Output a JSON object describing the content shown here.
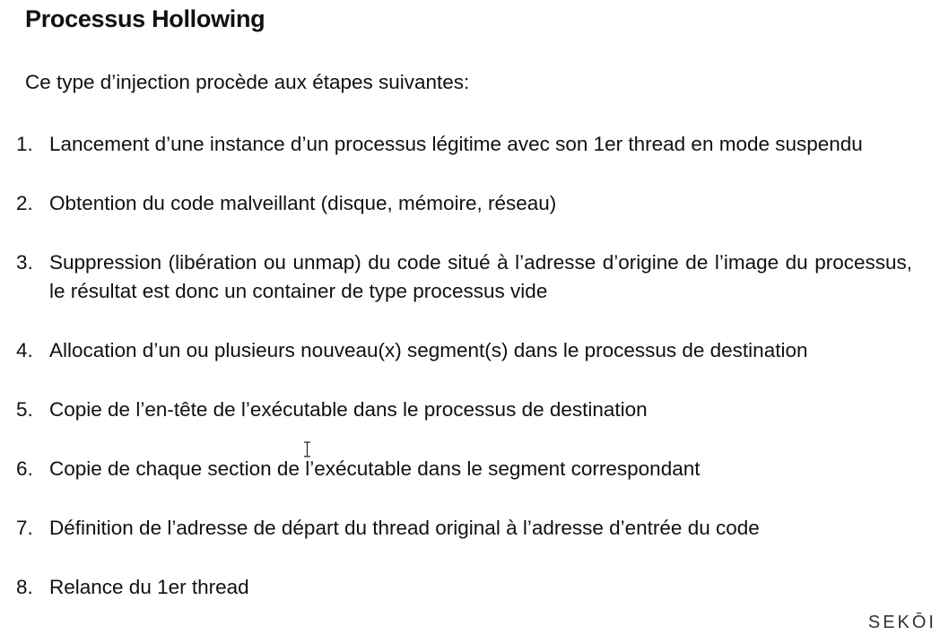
{
  "title": "Processus Hollowing",
  "intro": "Ce type d’injection procède aux étapes suivantes:",
  "steps": [
    {
      "num": "1.",
      "text": "Lancement d’une instance d’un processus légitime avec son 1er thread en mode suspendu"
    },
    {
      "num": "2.",
      "text": "Obtention du code malveillant (disque, mémoire, réseau)"
    },
    {
      "num": "3.",
      "text": "Suppression (libération ou unmap) du code situé à l’adresse d’origine de l’image du processus, le résultat est donc un container de type processus vide"
    },
    {
      "num": "4.",
      "text": "Allocation d’un ou plusieurs nouveau(x) segment(s) dans le processus de destination"
    },
    {
      "num": "5.",
      "text": "Copie de l’en-tête de l’exécutable dans le processus de destination"
    },
    {
      "num": "6.",
      "text": "Copie de chaque section de l’exécutable dans le segment correspondant"
    },
    {
      "num": "7.",
      "text": "Définition de l’adresse de départ du thread original à l’adresse d’entrée du code"
    },
    {
      "num": "8.",
      "text": "Relance du 1er thread"
    }
  ],
  "brand": "SEKŌI",
  "cursor_icon": "text-cursor-icon"
}
